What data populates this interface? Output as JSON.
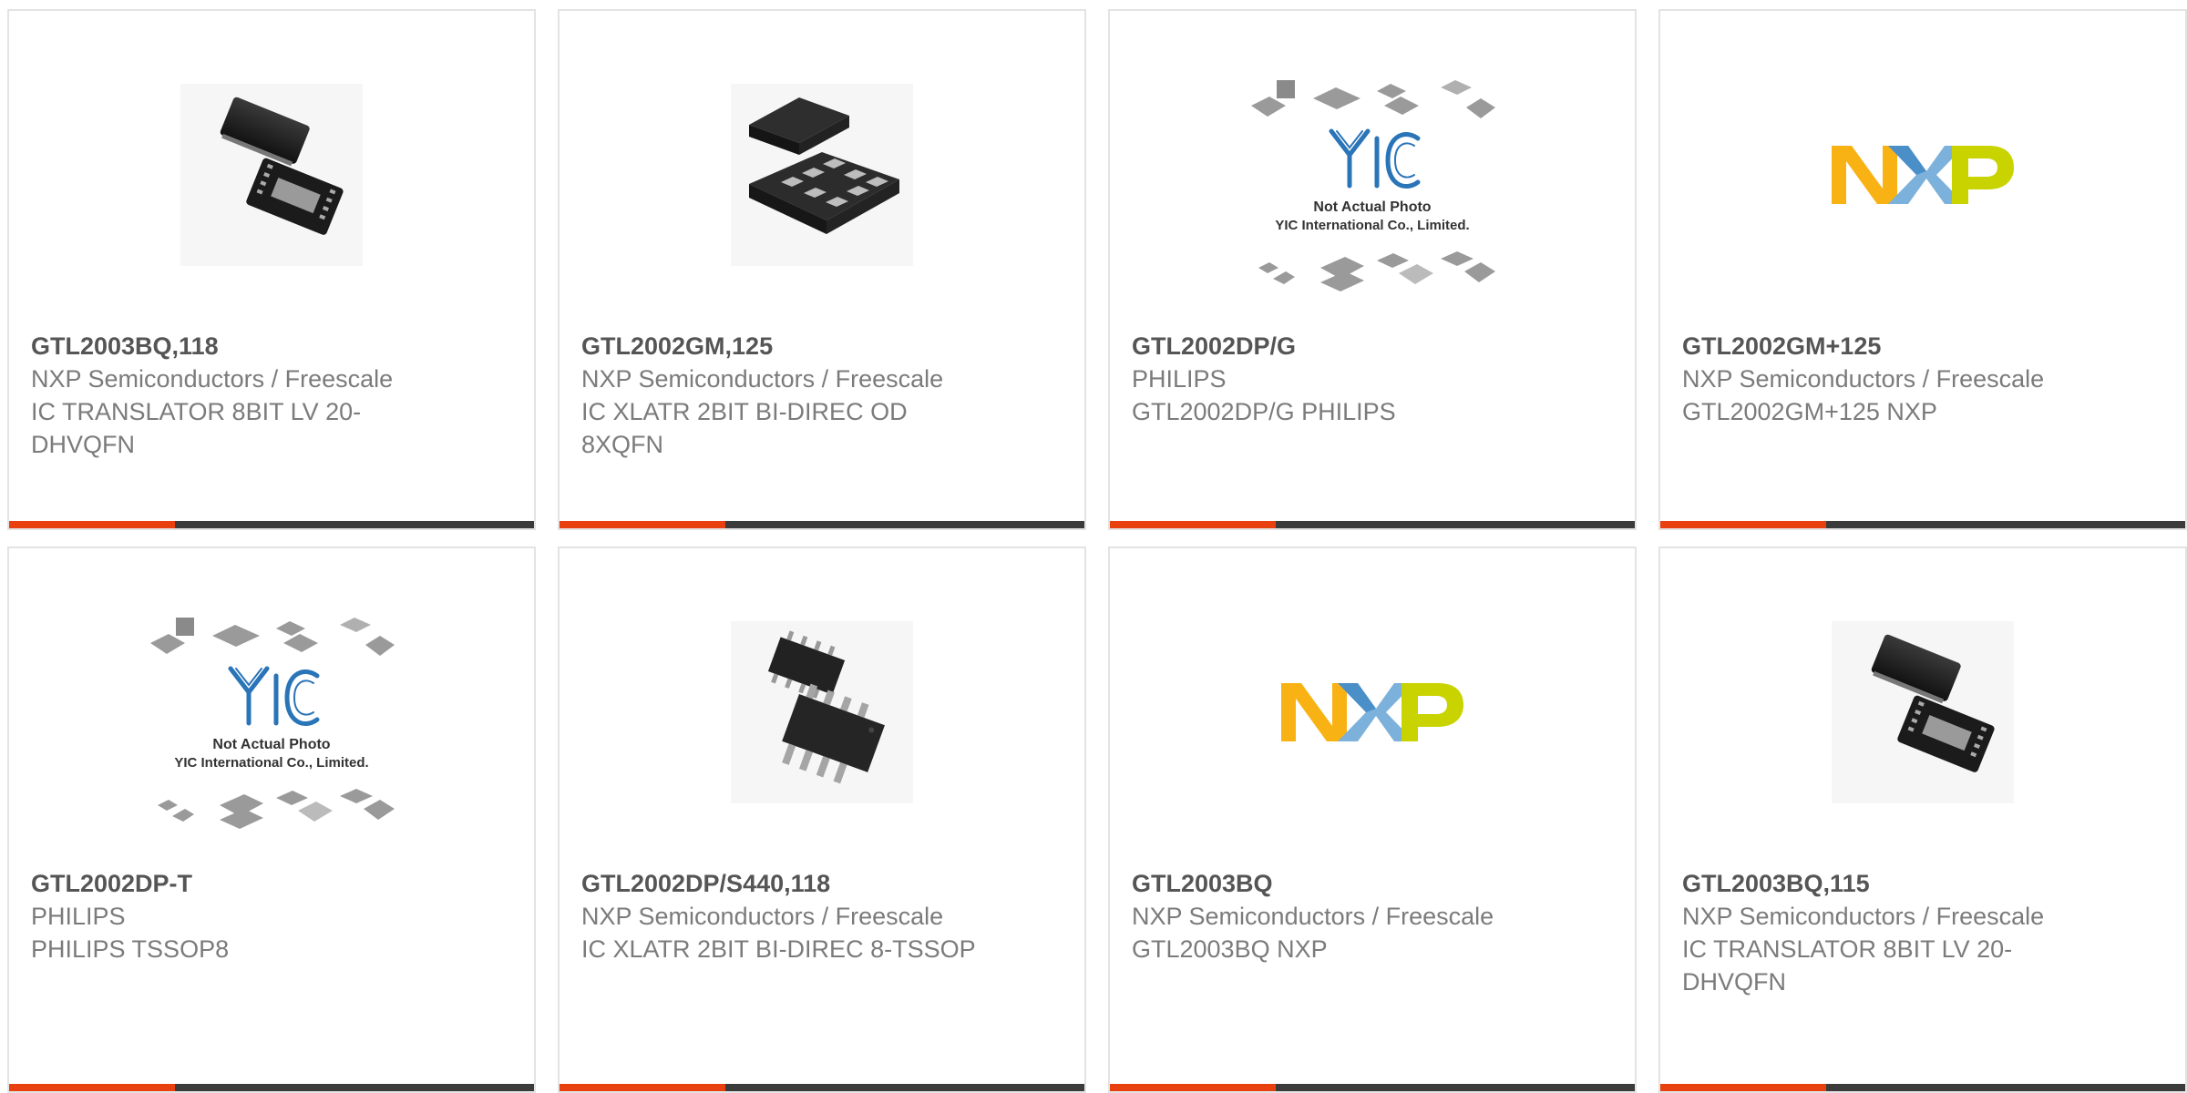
{
  "colors": {
    "accent": "#e8410f",
    "bar": "#3b3b3b",
    "border": "#e3e3e3",
    "title": "#555555",
    "text": "#7b7b7b"
  },
  "products": [
    {
      "part": "GTL2003BQ,118",
      "maker": "NXP Semiconductors / Freescale",
      "desc": "IC TRANSLATOR 8BIT LV 20-DHVQFN",
      "image": "chip-dhvqfn-icon"
    },
    {
      "part": "GTL2002GM,125",
      "maker": "NXP Semiconductors / Freescale",
      "desc": "IC XLATR 2BIT BI-DIREC OD 8XQFN",
      "image": "chip-xqfn-icon"
    },
    {
      "part": "GTL2002DP/G",
      "maker": "PHILIPS",
      "desc": "GTL2002DP/G PHILIPS",
      "image": "yic-placeholder-icon"
    },
    {
      "part": "GTL2002GM+125",
      "maker": "NXP Semiconductors / Freescale",
      "desc": "GTL2002GM+125 NXP",
      "image": "nxp-logo"
    },
    {
      "part": "GTL2002DP-T",
      "maker": "PHILIPS",
      "desc": "PHILIPS TSSOP8",
      "image": "yic-placeholder-icon"
    },
    {
      "part": "GTL2002DP/S440,118",
      "maker": "NXP Semiconductors / Freescale",
      "desc": "IC XLATR 2BIT BI-DIREC 8-TSSOP",
      "image": "chip-tssop-icon"
    },
    {
      "part": "GTL2003BQ",
      "maker": "NXP Semiconductors / Freescale",
      "desc": "GTL2003BQ NXP",
      "image": "nxp-logo"
    },
    {
      "part": "GTL2003BQ,115",
      "maker": "NXP Semiconductors / Freescale",
      "desc": "IC TRANSLATOR 8BIT LV 20-DHVQFN",
      "image": "chip-dhvqfn-icon"
    }
  ],
  "placeholder": {
    "line1": "Not Actual Photo",
    "line2": "YIC International Co., Limited.",
    "logo": "YIC"
  },
  "nxp_logo_text": "NXP"
}
